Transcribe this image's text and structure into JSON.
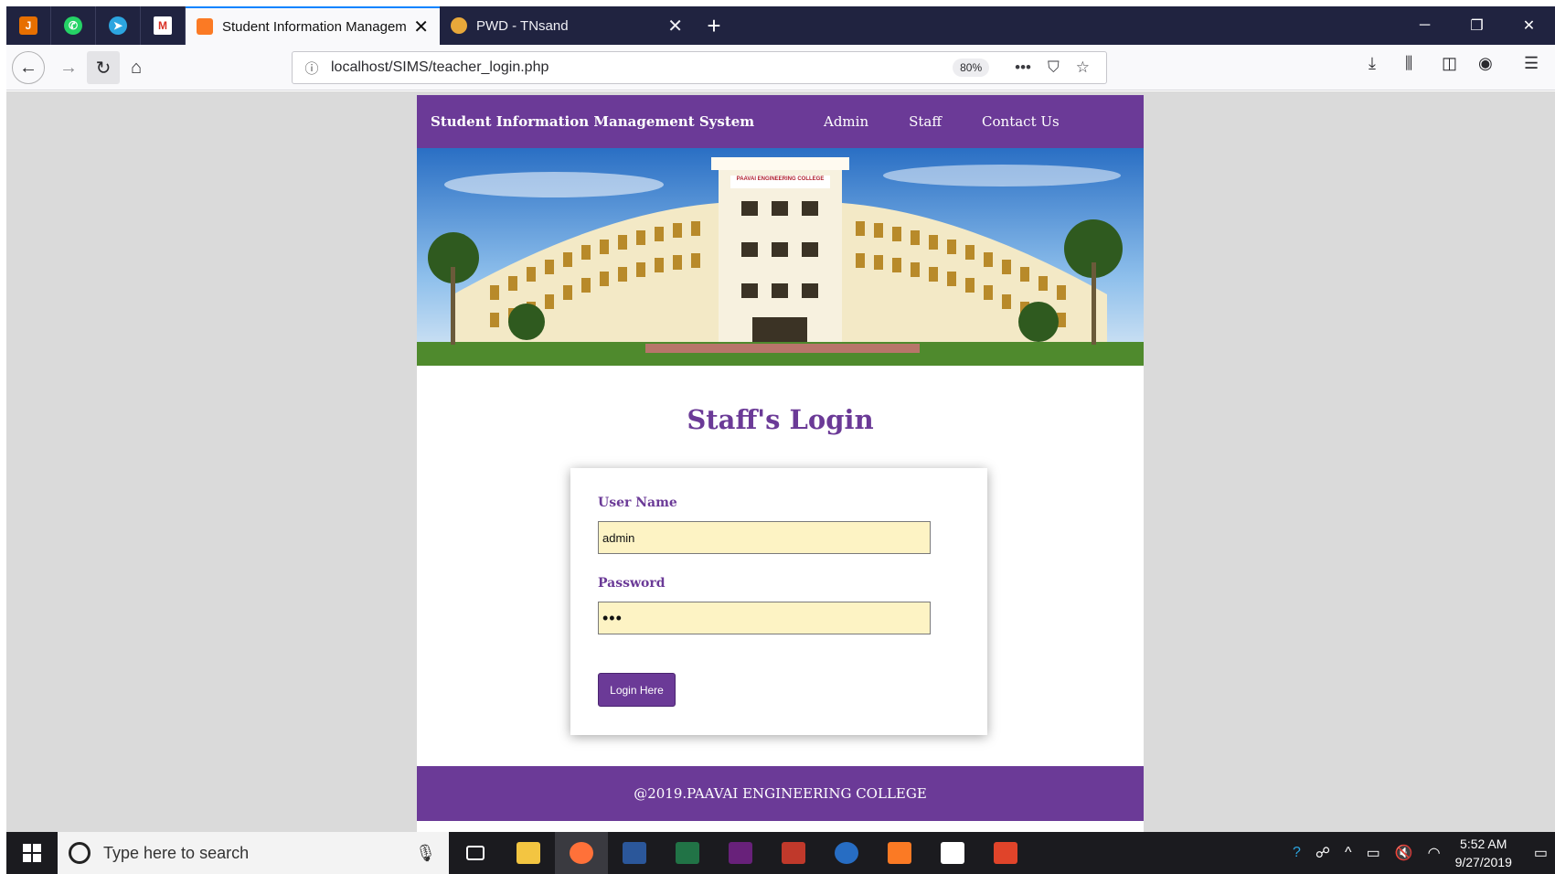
{
  "browser": {
    "pinned_tabs": [
      "java-icon",
      "whatsapp-icon",
      "telegram-icon",
      "gmail-icon"
    ],
    "tabs": [
      {
        "title": "Student Information Managem",
        "active": true,
        "favicon": "xampp-icon"
      },
      {
        "title": "PWD - TNsand",
        "active": false,
        "favicon": "globe-icon"
      }
    ],
    "url": "localhost/SIMS/teacher_login.php",
    "zoom": "80%",
    "page_actions": "•••"
  },
  "site": {
    "brand": "Student Information Management System",
    "menu": [
      "Admin",
      "Staff",
      "Contact Us"
    ],
    "banner_sign": "PAAVAI ENGINEERING COLLEGE",
    "heading": "Staff's Login",
    "form": {
      "username_label": "User Name",
      "username_value": "admin",
      "password_label": "Password",
      "password_value": "•••",
      "submit_label": "Login Here"
    },
    "footer": "@2019.PAAVAI ENGINEERING COLLEGE"
  },
  "taskbar": {
    "search_placeholder": "Type here to search",
    "time": "5:52 AM",
    "date": "9/27/2019"
  },
  "colors": {
    "brand_purple": "#6b3a97",
    "input_bg": "#fdf3c4",
    "tabbar_bg": "#202340"
  }
}
